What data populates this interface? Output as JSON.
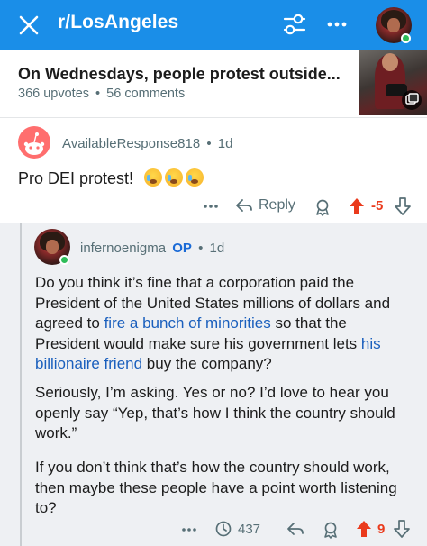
{
  "header": {
    "subreddit": "r/LosAngeles",
    "accent": "#1a8ee8"
  },
  "post": {
    "title": "On Wednesdays, people protest outside...",
    "upvotes": "366 upvotes",
    "separator": "•",
    "comments": "56 comments"
  },
  "comment1": {
    "username": "AvailableResponse818",
    "dot": "•",
    "age": "1d",
    "body": "Pro DEI protest!",
    "emojis": [
      "loudly-crying-face",
      "loudly-crying-face",
      "loudly-crying-face"
    ],
    "reply_label": "Reply",
    "score": "-5"
  },
  "comment2": {
    "username": "infernoenigma",
    "op_badge": "OP",
    "dot": "•",
    "age": "1d",
    "p1_a": "Do you think it’s fine that a corporation paid the President of the United States millions of dollars and agreed to ",
    "p1_link1": "fire a bunch of minorities",
    "p1_b": " so that the President would make sure his government lets ",
    "p1_link2": "his billionaire friend",
    "p1_c": " buy the company?",
    "p2": "Seriously, I’m asking. Yes or no? I’d love to hear you openly say “Yep, that’s how I think the country should work.”",
    "p3": "If you don’t think that’s how the country should work, then maybe these people have a point worth listening to?",
    "views": "437",
    "score": "9"
  },
  "colors": {
    "upvote_active": "#ea3a1c",
    "link": "#1a5fbd",
    "op_badge": "#1a6ad6",
    "meta_gray": "#576f76",
    "online": "#2ebd59"
  }
}
